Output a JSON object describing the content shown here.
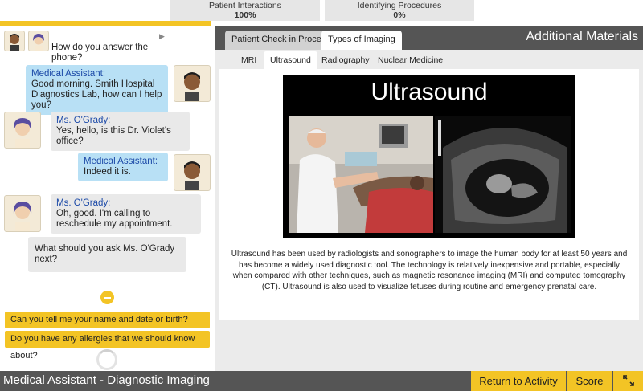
{
  "progress": {
    "interactions": {
      "label": "Patient Interactions",
      "value": "100%"
    },
    "procedures": {
      "label": "Identifying Procedures",
      "value": "0%"
    }
  },
  "chat": {
    "messages": [
      {
        "text": "How do you answer the phone?"
      },
      {
        "speaker": "Medical Assistant:",
        "text": "Good morning. Smith Hospital Diagnostics Lab, how can I help you?"
      },
      {
        "speaker": "Ms. O'Grady:",
        "text": "Yes, hello, is this Dr. Violet's office?"
      },
      {
        "speaker": "Medical Assistant:",
        "text": "Indeed it is."
      },
      {
        "speaker": "Ms. O'Grady:",
        "text": "Oh, good. I'm calling to reschedule my appointment."
      },
      {
        "text": "What should you ask Ms. O'Grady next?"
      }
    ],
    "choices": [
      "Can you tell me your name and date or birth?",
      "Do you have any allergies that we should know about?"
    ]
  },
  "panel": {
    "tabs": [
      "Patient Check in Process",
      "Types of Imaging"
    ],
    "title": "Additional Materials",
    "subtabs": [
      "MRI",
      "Ultrasound",
      "Radiography",
      "Nuclear Medicine"
    ],
    "figure_title": "Ultrasound",
    "description": "Ultrasound has been used by radiologists and sonographers to image the human body for at least 50 years and has become a widely used diagnostic tool. The technology is relatively inexpensive and portable, especially when compared with other techniques, such as magnetic resonance imaging (MRI) and computed tomography (CT). Ultrasound is also used to visualize fetuses during routine and emergency prenatal care."
  },
  "footer": {
    "title": "Medical Assistant - Diagnostic Imaging",
    "return_label": "Return to Activity",
    "score_label": "Score",
    "expand_icon": "expand-icon"
  },
  "colors": {
    "accent": "#f3c425",
    "dark": "#555555",
    "assistant_bubble": "#b8e0f5",
    "patient_bubble": "#e9e9e9"
  }
}
